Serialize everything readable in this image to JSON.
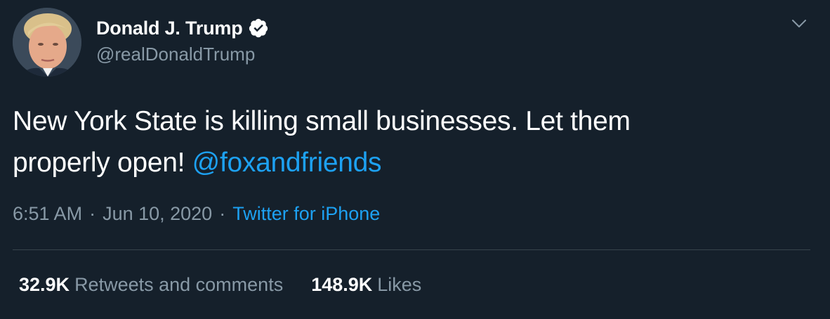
{
  "author": {
    "display_name": "Donald J. Trump",
    "handle": "@realDonaldTrump",
    "verified": true,
    "avatar_icon": "profile-photo"
  },
  "tweet": {
    "text_line1": "New York State is killing small businesses. Let them",
    "text_line2_prefix": "properly open! ",
    "mention": "@foxandfriends"
  },
  "meta": {
    "time": "6:51 AM",
    "separator": "·",
    "date": "Jun 10, 2020",
    "source": "Twitter for iPhone"
  },
  "stats": {
    "retweets_count": "32.9K",
    "retweets_label": "Retweets and comments",
    "likes_count": "148.9K",
    "likes_label": "Likes"
  },
  "colors": {
    "background": "#15202b",
    "accent": "#1da1f2",
    "secondary_text": "#8899a6",
    "divider": "#38444d"
  },
  "icons": {
    "verified": "verified-badge-icon",
    "caret": "chevron-down-icon"
  }
}
